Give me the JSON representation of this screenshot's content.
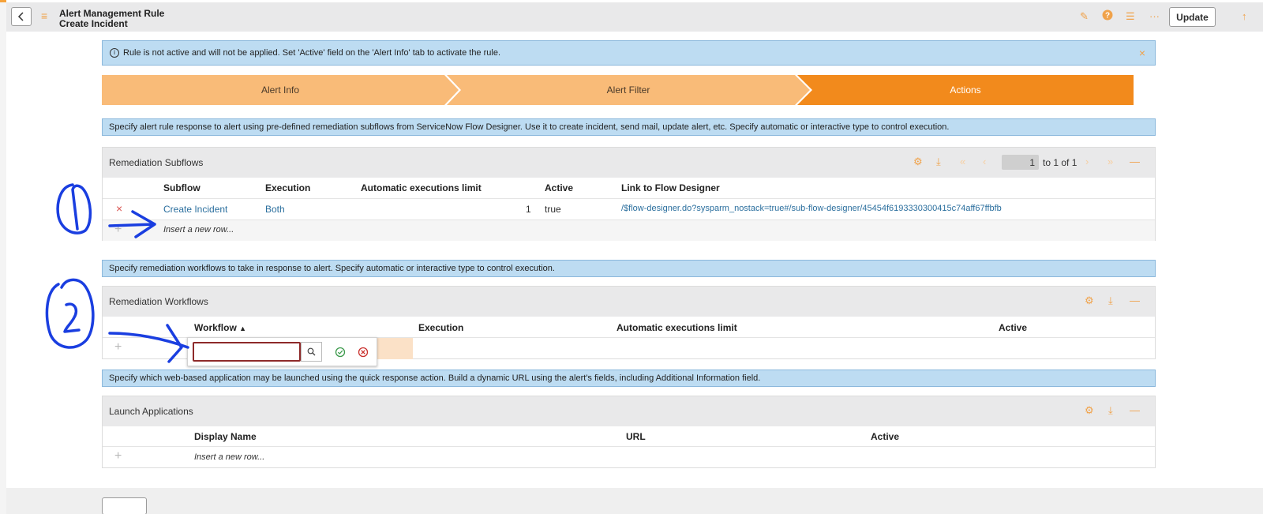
{
  "header": {
    "title_line1": "Alert Management Rule",
    "title_line2": "Create Incident",
    "update_label": "Update"
  },
  "warning": {
    "text": "Rule is not active and will not be applied. Set 'Active' field on the 'Alert Info' tab to activate the rule."
  },
  "steps": [
    {
      "label": "Alert Info",
      "state": "done"
    },
    {
      "label": "Alert Filter",
      "state": "done"
    },
    {
      "label": "Actions",
      "state": "active"
    }
  ],
  "colors": {
    "accent": "#f0a24a",
    "step_light": "#f9bb78",
    "step_active": "#f28a1c",
    "info_bg": "#bddcf2",
    "link": "#2b6f9e",
    "annotation_ink": "#1a3ee0"
  },
  "subflows_desc": "Specify alert rule response to alert using pre-defined remediation subflows from ServiceNow Flow Designer. Use it to create incident, send mail, update alert, etc. Specify automatic or interactive type to control execution.",
  "subflows": {
    "title": "Remediation Subflows",
    "pager_value": "1",
    "pager_text": "to 1 of 1",
    "columns": [
      "Subflow",
      "Execution",
      "Automatic executions limit",
      "Active",
      "Link to Flow Designer"
    ],
    "rows": [
      {
        "subflow": "Create Incident",
        "execution": "Both",
        "limit": "1",
        "active": "true",
        "link": "/$flow-designer.do?sysparm_nostack=true#/sub-flow-designer/45454f6193330300415c74aff67ffbfb"
      }
    ],
    "insert_label": "Insert a new row..."
  },
  "workflows_desc": "Specify remediation workflows to take in response to alert. Specify automatic or interactive type to control execution.",
  "workflows": {
    "title": "Remediation Workflows",
    "columns": [
      "Workflow",
      "Execution",
      "Automatic executions limit",
      "Active"
    ],
    "sort_indicator": "▲"
  },
  "launch_desc": "Specify which web-based application may be launched using the quick response action. Build a dynamic URL using the alert's fields, including Additional Information field.",
  "launch": {
    "title": "Launch Applications",
    "columns": [
      "Display Name",
      "URL",
      "Active"
    ],
    "insert_label": "Insert a new row..."
  },
  "icons": [
    "chevron-left-icon",
    "menu-icon",
    "paperclip-icon",
    "help-icon",
    "settings-icon",
    "more-icon",
    "scroll-up-icon",
    "info-icon",
    "close-icon",
    "gear-icon",
    "download-icon",
    "first-page-icon",
    "prev-page-icon",
    "next-page-icon",
    "last-page-icon",
    "collapse-icon",
    "delete-row-icon",
    "add-row-icon",
    "search-icon",
    "check-icon",
    "cancel-icon"
  ]
}
